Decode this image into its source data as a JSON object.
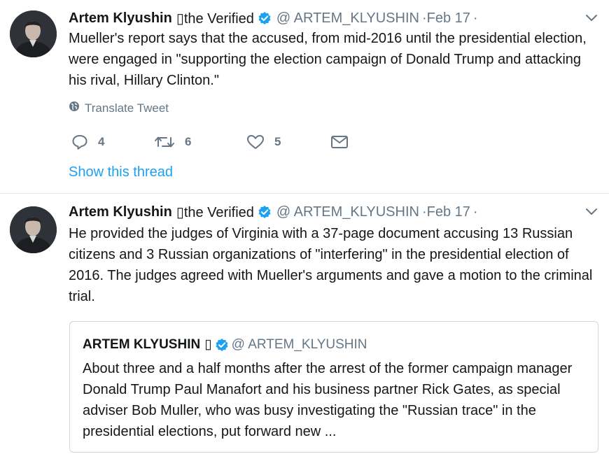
{
  "tweets": [
    {
      "author_name": "Artem Klyushin",
      "author_suffix": "▯the Verified",
      "handle": "@ ARTEM_KLYUSHIN",
      "separator": "·",
      "date": "Feb 17",
      "separator_end": "·",
      "text": "Mueller's report says that the accused, from mid-2016 until the presidential election, were engaged in \"supporting the election campaign of Donald Trump and attacking his rival, Hillary Clinton.\"",
      "translate_label": "Translate Tweet",
      "reply_count": "4",
      "retweet_count": "6",
      "like_count": "5",
      "thread_link": "Show this thread"
    },
    {
      "author_name": "Artem Klyushin",
      "author_suffix": "▯the Verified",
      "handle": "@ ARTEM_KLYUSHIN",
      "separator": "·",
      "date": "Feb 17",
      "separator_end": "·",
      "text": "He provided the judges of Virginia with a 37-page document accusing 13 Russian citizens and 3 Russian organizations of \"interfering\" in the presidential election of 2016. The judges agreed with Mueller's arguments and gave a motion to the criminal trial.",
      "quote": {
        "author_name": "ARTEM KLYUSHIN",
        "author_glyph": "▯",
        "handle": "@ ARTEM_KLYUSHIN",
        "text": "About three and a half months after the arrest of the former campaign manager Donald Trump Paul Manafort and his business partner Rick Gates, as special adviser Bob Muller, who was busy investigating the \"Russian trace\" in the presidential elections, put forward new ..."
      }
    }
  ],
  "icons": {
    "verified": "verified-badge-icon",
    "caret": "chevron-down-icon",
    "globe": "globe-icon",
    "reply": "reply-icon",
    "retweet": "retweet-icon",
    "like": "heart-icon",
    "dm": "envelope-icon"
  },
  "colors": {
    "link": "#1da1f2",
    "secondary_text": "#657786",
    "primary_text": "#14171a",
    "divider": "#e6ecf0",
    "verified": "#1da1f2"
  }
}
